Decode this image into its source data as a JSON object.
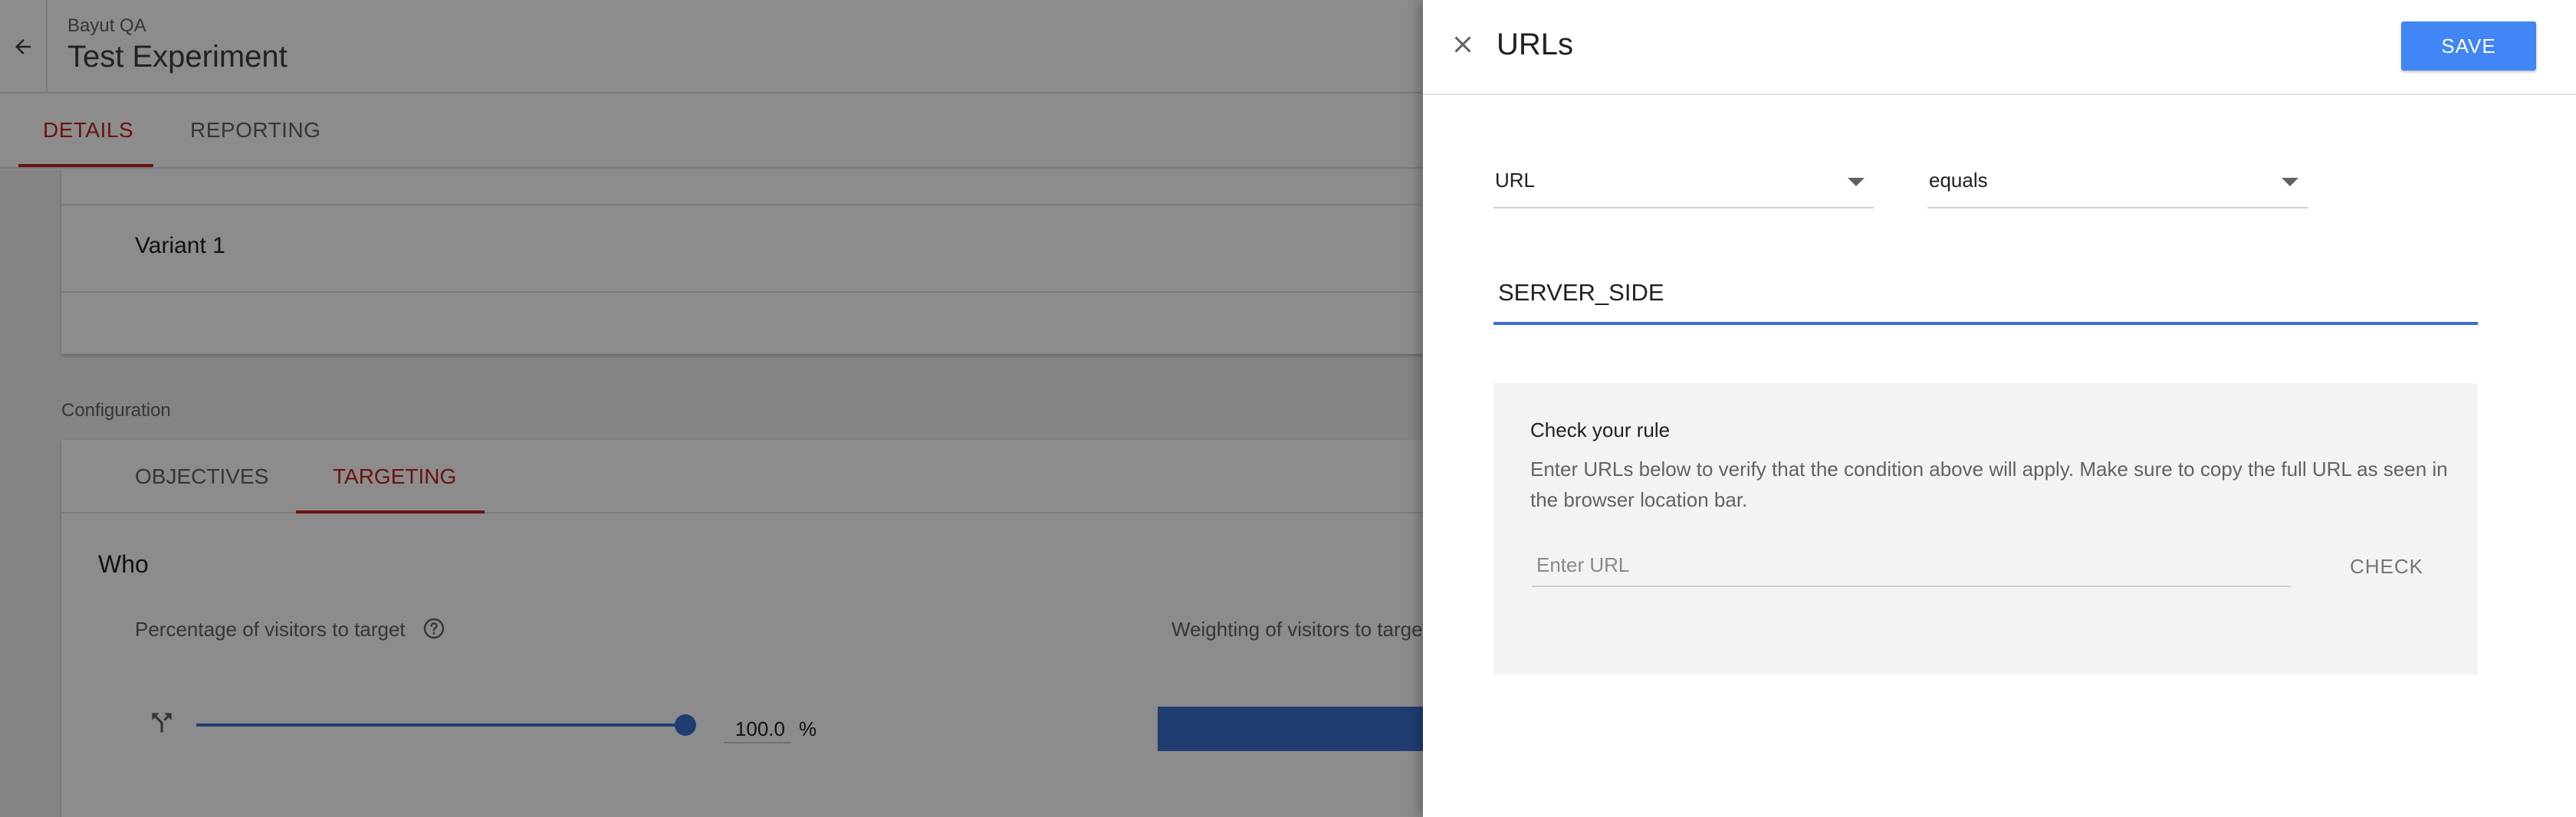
{
  "header": {
    "account": "Bayut QA",
    "experiment_title": "Test Experiment"
  },
  "main_tabs": [
    {
      "label": "DETAILS",
      "active": true
    },
    {
      "label": "REPORTING",
      "active": false
    }
  ],
  "variants": {
    "variant_label": "Variant 1"
  },
  "configuration": {
    "section_label": "Configuration",
    "tabs": [
      {
        "label": "OBJECTIVES",
        "active": false
      },
      {
        "label": "TARGETING",
        "active": true
      }
    ],
    "who_label": "Who",
    "percentage_label": "Percentage of visitors to target",
    "percentage_value": "100.0",
    "percentage_unit": "%",
    "slider_level": 1.0,
    "weighting_label": "Weighting of visitors to target"
  },
  "panel": {
    "title": "URLs",
    "save_label": "SAVE",
    "condition": {
      "field": "URL",
      "operator": "equals",
      "value": "SERVER_SIDE"
    },
    "rule_check": {
      "title": "Check your rule",
      "description": "Enter URLs below to verify that the condition above will apply. Make sure to copy the full URL as seen in the browser location bar.",
      "url_placeholder": "Enter URL",
      "check_label": "CHECK"
    }
  },
  "colors": {
    "accent_blue": "#4285f4",
    "active_tab_red": "#c5221f",
    "focus_blue": "#3b6fd0"
  },
  "icons": [
    "back-arrow-icon",
    "help-circle-icon",
    "split-arrows-icon",
    "close-icon",
    "dropdown-caret-icon"
  ]
}
